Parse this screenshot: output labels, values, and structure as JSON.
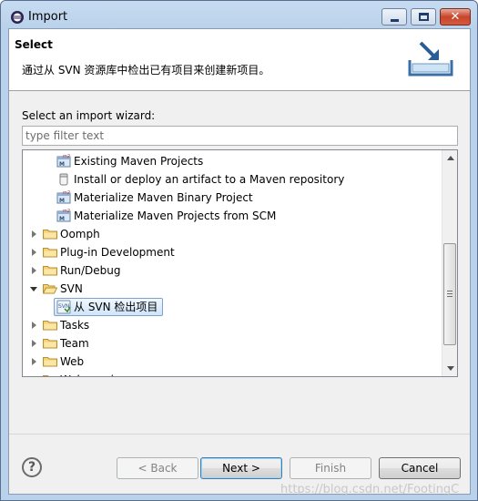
{
  "window": {
    "title": "Import",
    "close_glyph": "✕"
  },
  "banner": {
    "title": "Select",
    "description": "通过从 SVN 资源库中检出已有项目来创建新项目。",
    "icon": "import-wizard-icon"
  },
  "wizard_label": "Select an import wizard:",
  "filter": {
    "placeholder": "type filter text",
    "value": ""
  },
  "tree": {
    "items": [
      {
        "label": "Existing Maven Projects",
        "kind": "maven",
        "level": 1
      },
      {
        "label": "Install or deploy an artifact to a Maven repository",
        "kind": "artifact",
        "level": 1
      },
      {
        "label": "Materialize Maven Binary Project",
        "kind": "maven",
        "level": 1
      },
      {
        "label": "Materialize Maven Projects from SCM",
        "kind": "maven",
        "level": 1
      },
      {
        "label": "Oomph",
        "kind": "folder",
        "expanded": false,
        "level": 0
      },
      {
        "label": "Plug-in Development",
        "kind": "folder",
        "expanded": false,
        "level": 0
      },
      {
        "label": "Run/Debug",
        "kind": "folder",
        "expanded": false,
        "level": 0
      },
      {
        "label": "SVN",
        "kind": "folder",
        "expanded": true,
        "level": 0
      },
      {
        "label": "从 SVN 检出项目",
        "kind": "svn",
        "level": 1,
        "selected": true
      },
      {
        "label": "Tasks",
        "kind": "folder",
        "expanded": false,
        "level": 0
      },
      {
        "label": "Team",
        "kind": "folder",
        "expanded": false,
        "level": 0
      },
      {
        "label": "Web",
        "kind": "folder",
        "expanded": false,
        "level": 0
      },
      {
        "label": "Web services",
        "kind": "folder",
        "expanded": false,
        "level": 0
      }
    ]
  },
  "buttons": {
    "help": "?",
    "back": "< Back",
    "next": "Next >",
    "finish": "Finish",
    "cancel": "Cancel"
  },
  "watermark": "https://blog.csdn.net/FootingC",
  "colors": {
    "selection": "#cfe4fa",
    "folder": "#e8c05a",
    "title_gradient": "#b9d1ea"
  }
}
